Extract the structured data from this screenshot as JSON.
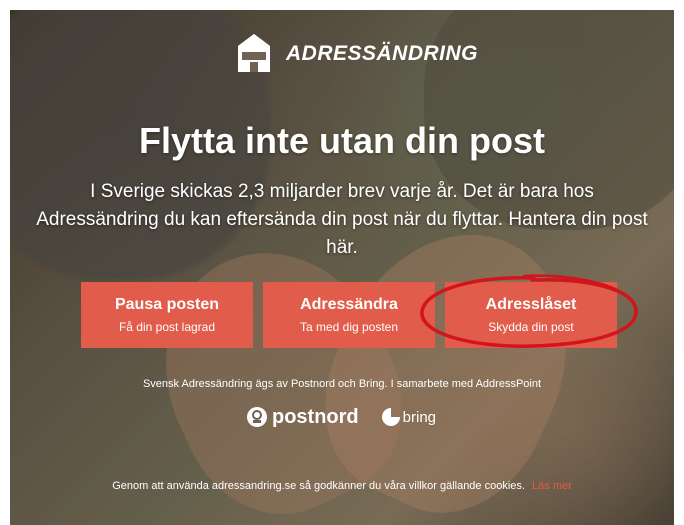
{
  "brand": {
    "name": "ADRESSÄNDRING",
    "logo_icon": "house-icon"
  },
  "hero": {
    "title": "Flytta inte utan din post",
    "intro": "I Sverige skickas 2,3 miljarder brev varje år. Det är bara hos Adressändring du kan eftersända din post när du flyttar. Hantera din post här."
  },
  "actions": [
    {
      "title": "Pausa posten",
      "subtitle": "Få din post lagrad"
    },
    {
      "title": "Adressändra",
      "subtitle": "Ta med dig posten"
    },
    {
      "title": "Adresslåset",
      "subtitle": "Skydda din post"
    }
  ],
  "colors": {
    "button": "#e15c4a",
    "annotation_circle": "#d3141b"
  },
  "owners_text": "Svensk Adressändring ägs av Postnord och Bring. I samarbete med AddressPoint",
  "partners": {
    "postnord": "postnord",
    "bring": "bring"
  },
  "cookie": {
    "text": "Genom att använda adressandring.se så godkänner du våra villkor gällande cookies.",
    "link": "Läs mer"
  }
}
